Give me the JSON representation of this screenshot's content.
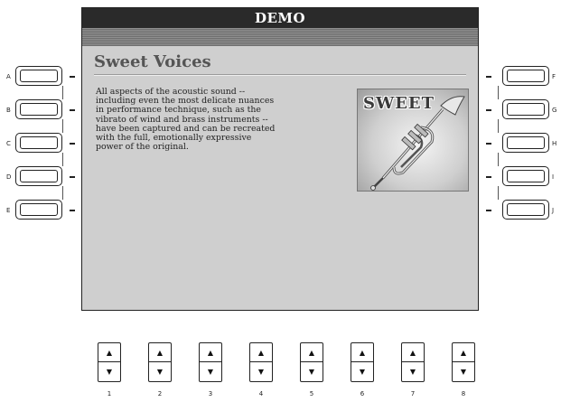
{
  "screen": {
    "title": "DEMO",
    "heading": "Sweet Voices",
    "body": "All aspects of the acoustic sound --\nincluding even the most delicate nuances\nin performance technique, such as the\nvibrato of wind and brass instruments --\nhave been captured and can be recreated\nwith the full, emotionally expressive\npower of the original.",
    "image_label": "SWEET",
    "image_icon": "trumpet-icon"
  },
  "left_buttons": [
    "A",
    "B",
    "C",
    "D",
    "E"
  ],
  "right_buttons": [
    "F",
    "G",
    "H",
    "I",
    "J"
  ],
  "bottom_buttons": {
    "numbers": [
      "1",
      "2",
      "3",
      "4",
      "5",
      "6",
      "7",
      "8"
    ],
    "up_glyph": "▲",
    "down_glyph": "▼"
  },
  "colors": {
    "screen_bg": "#cfcfcf",
    "title_bar": "#2a2a2a"
  }
}
